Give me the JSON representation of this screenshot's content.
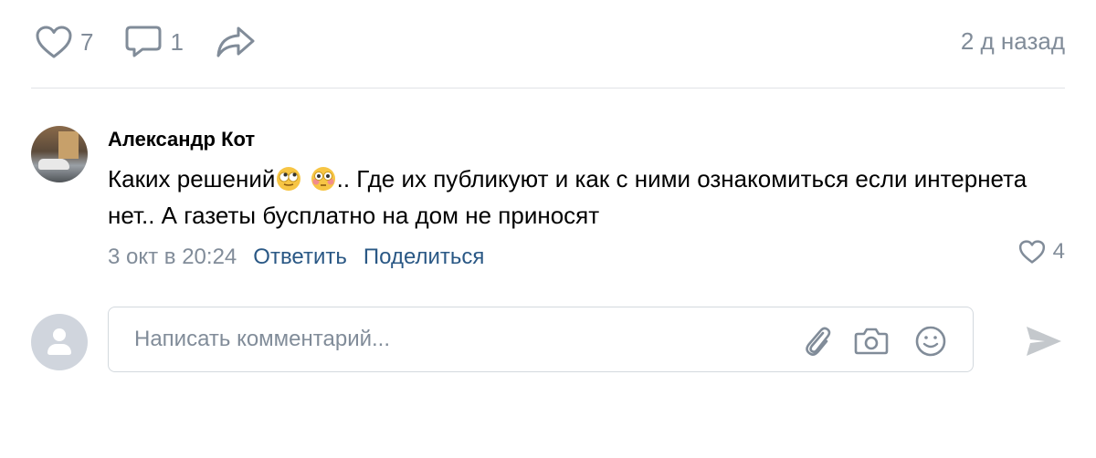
{
  "post_actions": {
    "likes_count": "7",
    "comments_count": "1",
    "time": "2 д назад"
  },
  "comment": {
    "author": "Александр Кот",
    "text_part1": "Каких решений",
    "text_part2": ".. Где их публикуют и как с ними ознакомиться если интернета нет.. А газеты бусплатно на дом не приносят",
    "date": "3 окт в 20:24",
    "reply_label": "Ответить",
    "share_label": "Поделиться",
    "likes_count": "4"
  },
  "composer": {
    "placeholder": "Написать комментарий..."
  },
  "colors": {
    "muted": "#818c99",
    "link": "#2a5885",
    "divider": "#e1e3e6"
  }
}
